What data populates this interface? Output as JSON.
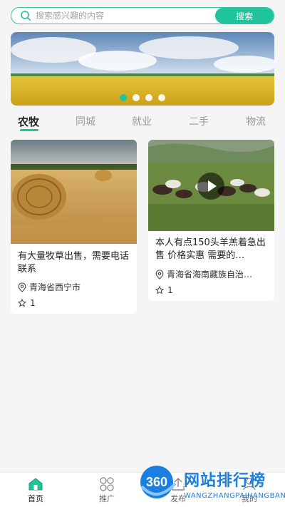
{
  "search": {
    "placeholder": "搜索感兴趣的内容",
    "button_label": "搜索"
  },
  "banner": {
    "slide_count": 4,
    "active_index": 0
  },
  "tabs": [
    {
      "label": "农牧",
      "active": true
    },
    {
      "label": "同城",
      "active": false
    },
    {
      "label": "就业",
      "active": false
    },
    {
      "label": "二手",
      "active": false
    },
    {
      "label": "物流",
      "active": false
    }
  ],
  "posts": [
    {
      "title": "有大量牧草出售，需要电话联系",
      "location": "青海省西宁市",
      "favorites": "1",
      "is_video": false
    },
    {
      "title": "本人有点150头羊羔着急出售 价格实惠 需要的…",
      "location": "青海省海南藏族自治…",
      "favorites": "1",
      "is_video": true
    }
  ],
  "bottom_nav": [
    {
      "label": "首页",
      "icon": "home-icon",
      "active": true
    },
    {
      "label": "推广",
      "icon": "grid-icon",
      "active": false
    },
    {
      "label": "发布",
      "icon": "upload-icon",
      "active": false
    },
    {
      "label": "我的",
      "icon": "user-icon",
      "active": false
    }
  ],
  "watermark": {
    "badge": "360",
    "title": "网站排行榜",
    "subtitle": "WANGZHANGPAIHANGBANG"
  },
  "colors": {
    "accent": "#21c39a",
    "watermark": "#1a7fe0"
  }
}
